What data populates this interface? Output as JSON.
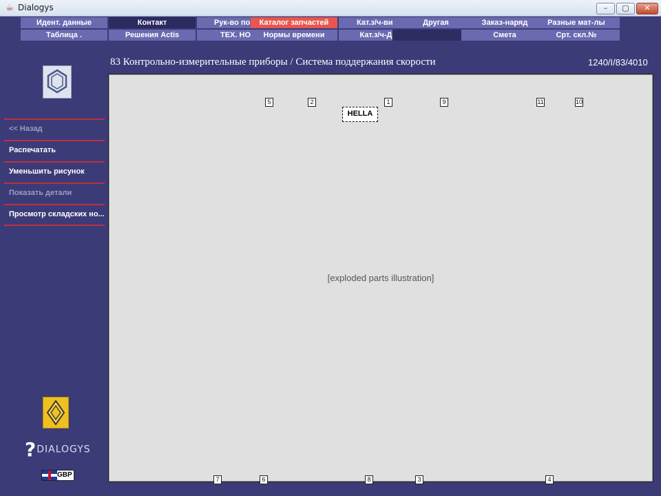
{
  "window": {
    "title": "Dialogys",
    "min_label": "–",
    "max_label": "▢",
    "close_label": "✕"
  },
  "nav": {
    "row1": [
      "Идент. данные",
      "Контакт",
      "Рук-во по рем",
      "Каталог запчастей",
      "Кат.з/ч-винты",
      "Другая",
      "Заказ-наряд",
      "Разные мат-лы"
    ],
    "row2": [
      "Таблица .",
      "Решения Actis",
      "ТЕХ. НОТА",
      "Нормы времени",
      "Кат.з/ч-Двиг",
      "",
      "Смета",
      "Срт. скл.№"
    ]
  },
  "sidebar": {
    "items": [
      {
        "label": "<< Назад",
        "enabled": false
      },
      {
        "label": "Распечатать",
        "enabled": true
      },
      {
        "label": "Уменьшить рисунок",
        "enabled": true
      },
      {
        "label": "Показать детали",
        "enabled": false
      },
      {
        "label": "Просмотр складских но...",
        "enabled": true
      }
    ],
    "brand": "DIALOGYS",
    "currency": "GBP"
  },
  "header": {
    "title": "83 Контрольно-измерительные приборы / Система поддержания скорости",
    "ref": "1240/I/83/4010"
  },
  "diagram": {
    "tag": "HELLA",
    "callouts": [
      "5",
      "2",
      "1",
      "9",
      "11",
      "10",
      "7",
      "6",
      "8",
      "3",
      "4"
    ]
  },
  "colors": {
    "background": "#3b3b78",
    "nav_button": "#6a6ab0",
    "nav_active": "#2b2b60",
    "nav_highlight": "#e8564f",
    "divider": "#c0303d"
  }
}
